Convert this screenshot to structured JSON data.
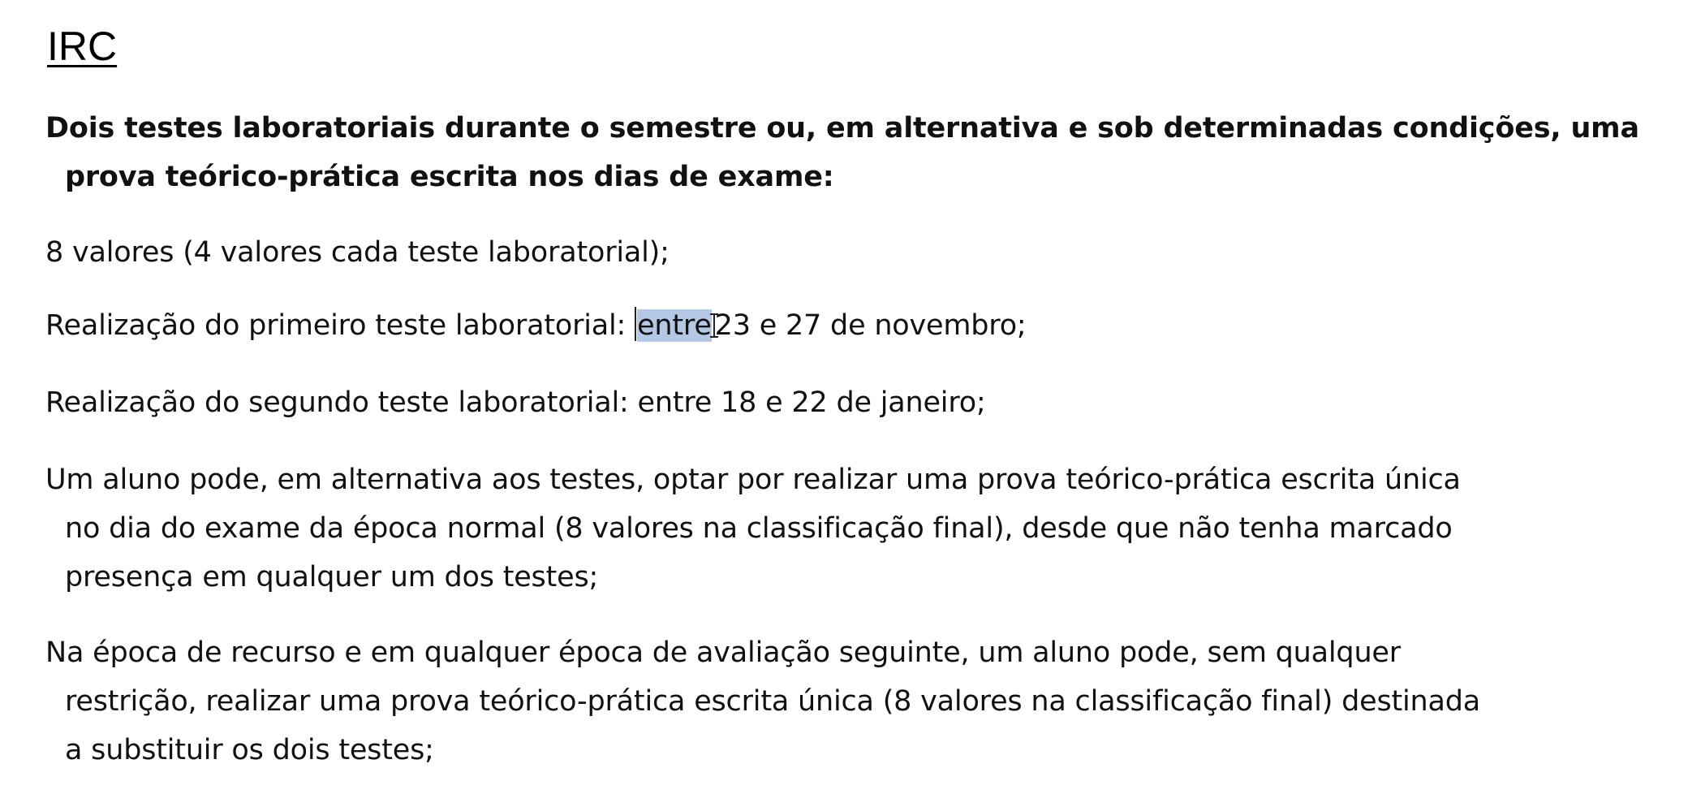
{
  "document": {
    "title": "IRC",
    "intro": {
      "line1": "Dois testes laboratoriais durante o semestre ou, em alternativa e sob determinadas condições, uma",
      "line2": "prova teórico-prática escrita nos dias de exame:"
    },
    "items": {
      "values": "8 valores (4 valores cada teste laboratorial);",
      "first_test": {
        "before": "Realização do primeiro teste laboratorial: ",
        "selected": "entre",
        "after": "23 e 27 de novembro;"
      },
      "second_test": "Realização do segundo teste laboratorial: entre 18 e 22 de janeiro;",
      "alternative": {
        "line1": "Um aluno pode, em alternativa aos testes, optar por realizar uma prova teórico-prática escrita única",
        "line2": "no dia do exame da época normal (8 valores na classificação final), desde que não tenha marcado",
        "line3": "presença em qualquer um dos testes;"
      },
      "recourse": {
        "line1": "Na época de recurso e em qualquer época de avaliação seguinte, um aluno pode, sem qualquer",
        "line2": "restrição, realizar uma prova teórico-prática escrita única (8 valores na classificação final) destinada",
        "line3": "a substituir os dois testes;"
      }
    }
  }
}
